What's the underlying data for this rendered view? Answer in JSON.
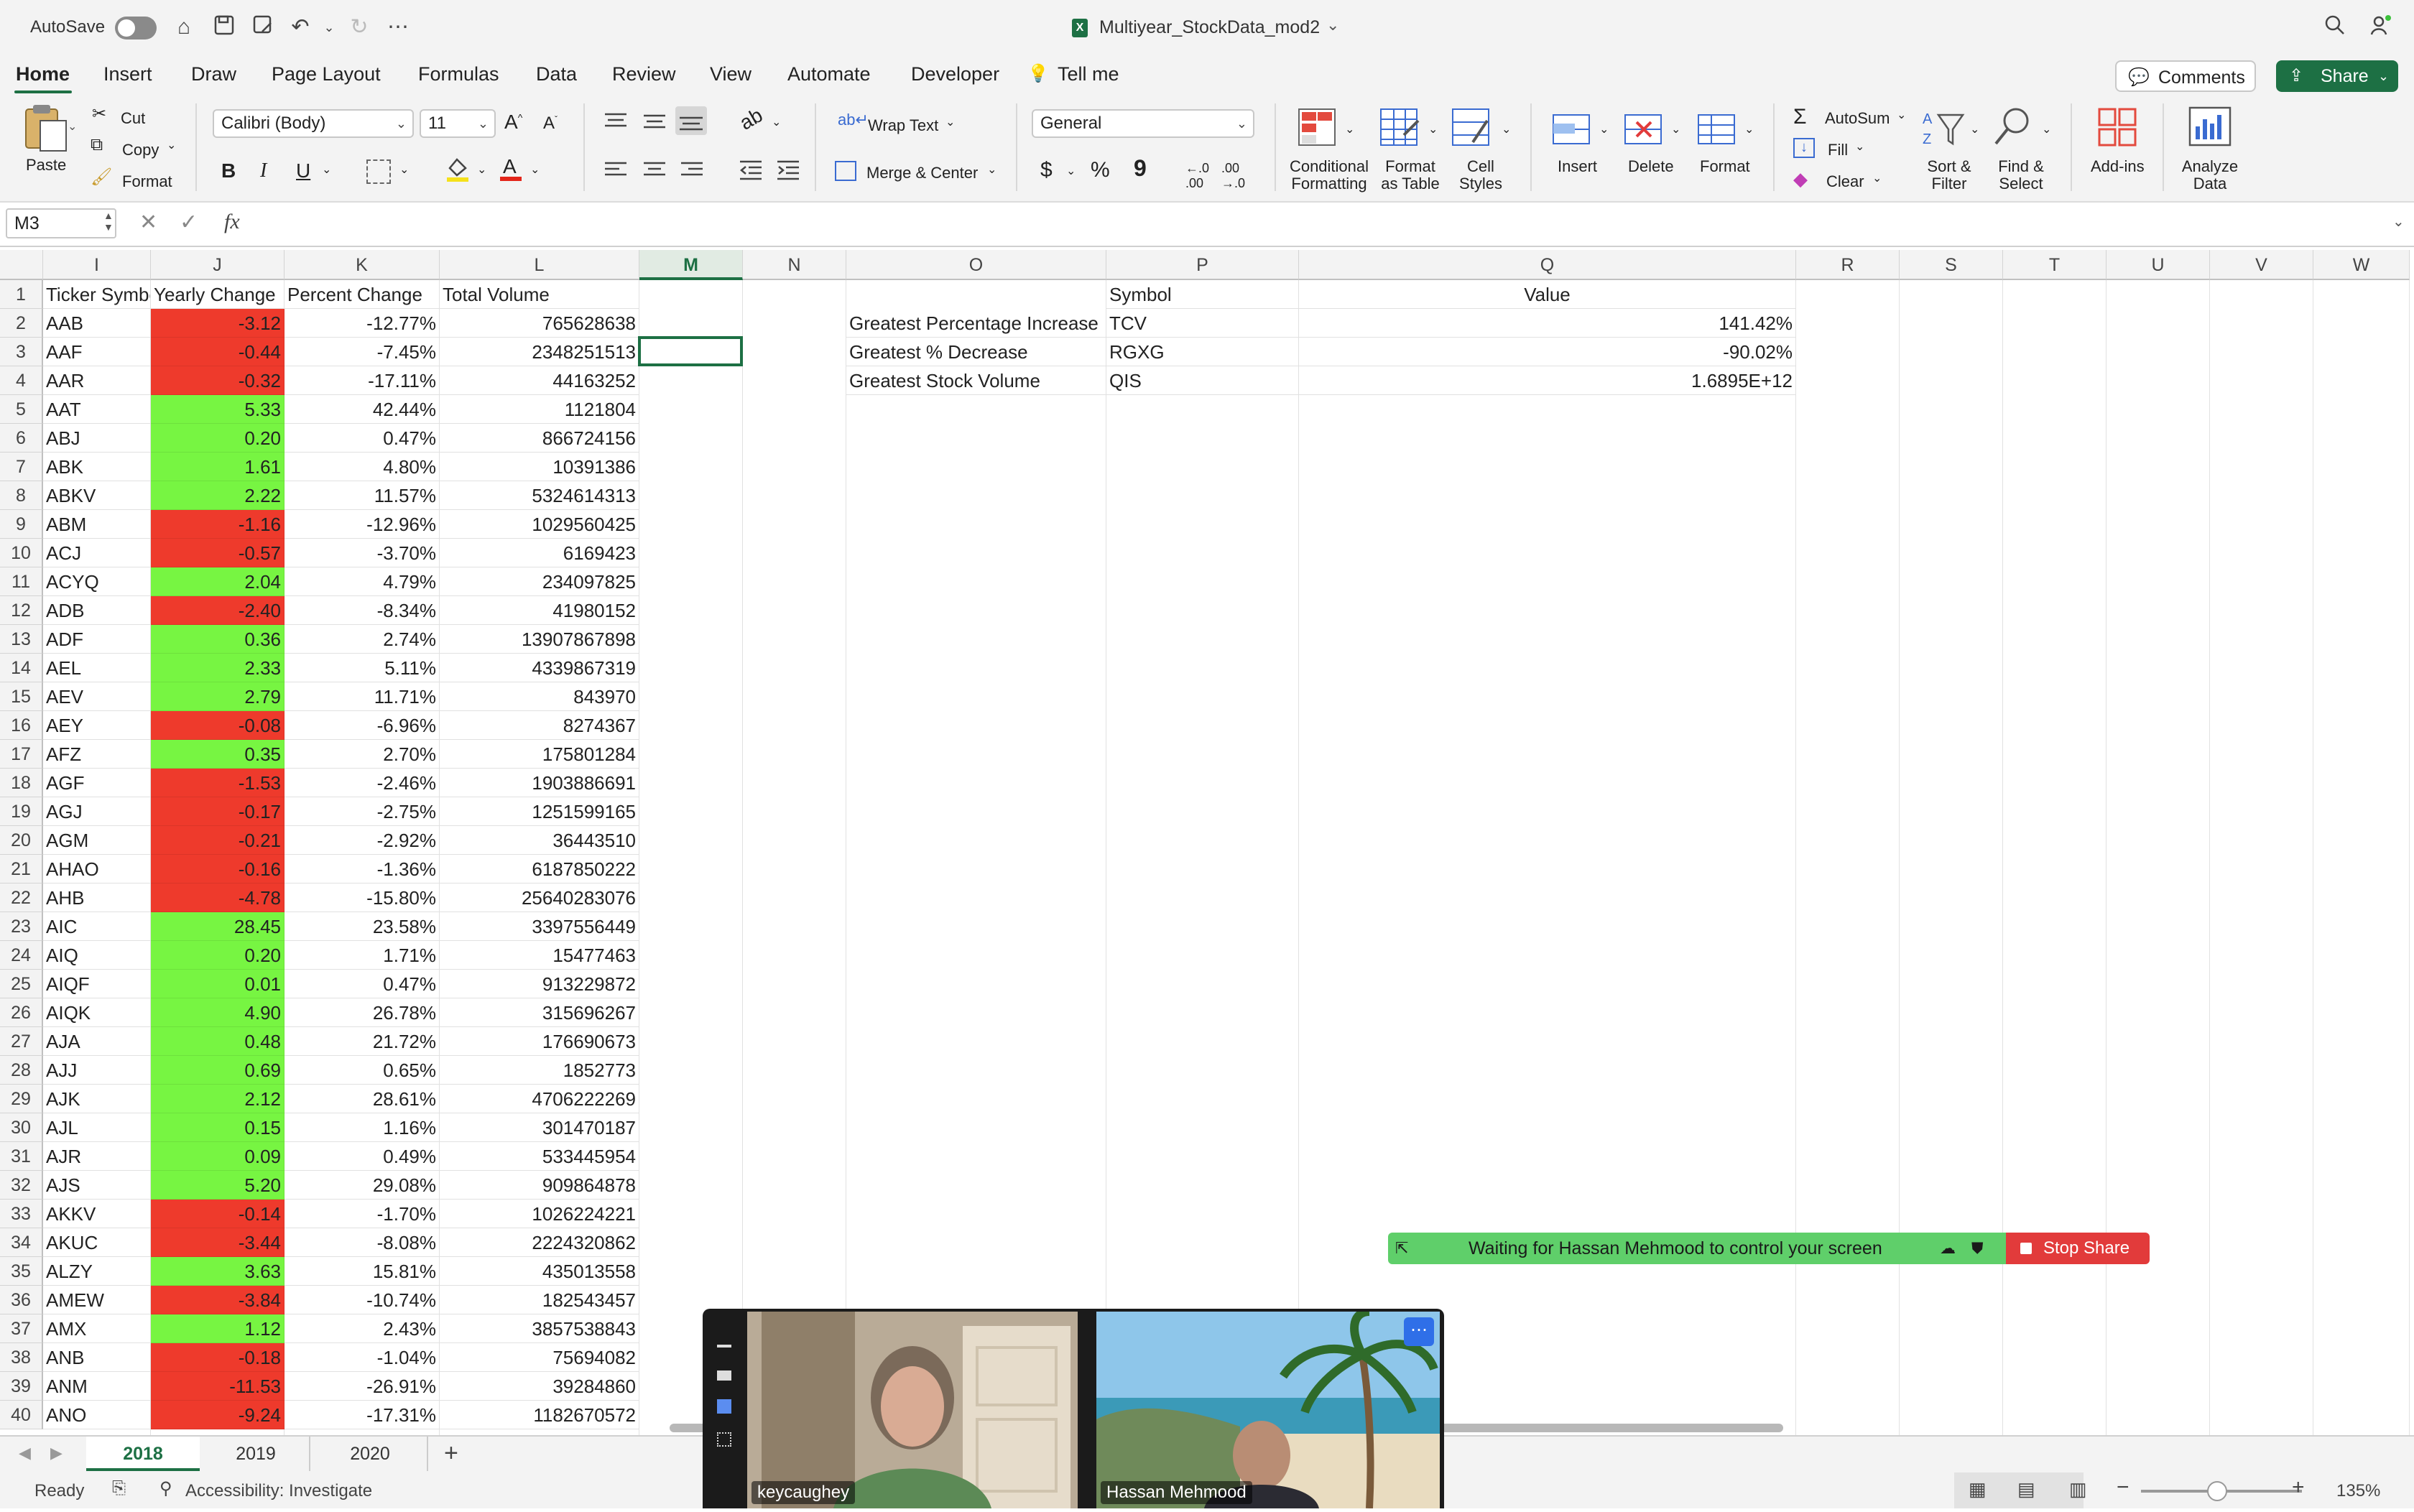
{
  "app": {
    "autosave_label": "AutoSave",
    "doc_title": "Multiyear_StockData_mod2",
    "tabs": [
      "Home",
      "Insert",
      "Draw",
      "Page Layout",
      "Formulas",
      "Data",
      "Review",
      "View",
      "Automate",
      "Developer",
      "Tell me"
    ],
    "comments_label": "Comments",
    "share_label": "Share"
  },
  "ribbon": {
    "paste": "Paste",
    "cut": "Cut",
    "copy": "Copy",
    "format_painter": "Format",
    "font_name": "Calibri (Body)",
    "font_size": "11",
    "bold": "B",
    "italic": "I",
    "underline": "U",
    "wrap_text": "Wrap Text",
    "merge_center": "Merge & Center",
    "number_format": "General",
    "conditional_formatting": [
      "Conditional",
      "Formatting"
    ],
    "format_as_table": [
      "Format",
      "as Table"
    ],
    "cell_styles": [
      "Cell",
      "Styles"
    ],
    "insert": "Insert",
    "delete": "Delete",
    "format": "Format",
    "autosum": "AutoSum",
    "fill": "Fill",
    "clear": "Clear",
    "sort_filter": [
      "Sort &",
      "Filter"
    ],
    "find_select": [
      "Find &",
      "Select"
    ],
    "addins": "Add-ins",
    "analyze_data": [
      "Analyze",
      "Data"
    ],
    "dollar": "$",
    "percent": "%",
    "comma": "9"
  },
  "formula_bar": {
    "name_box": "M3",
    "fx": "fx",
    "content": ""
  },
  "columns": [
    "I",
    "J",
    "K",
    "L",
    "M",
    "N",
    "O",
    "P",
    "Q",
    "R",
    "S",
    "T",
    "U",
    "V",
    "W"
  ],
  "selected_column": "M",
  "headers": {
    "ticker": "Ticker Symbol",
    "yearly": "Yearly Change",
    "percent": "Percent Change",
    "volume": "Total Volume",
    "symbol": "Symbol",
    "value": "Value"
  },
  "rows": [
    {
      "ticker": "AAB",
      "yearly": "-3.12",
      "percent": "-12.77%",
      "volume": "765628638"
    },
    {
      "ticker": "AAF",
      "yearly": "-0.44",
      "percent": "-7.45%",
      "volume": "2348251513"
    },
    {
      "ticker": "AAR",
      "yearly": "-0.32",
      "percent": "-17.11%",
      "volume": "44163252"
    },
    {
      "ticker": "AAT",
      "yearly": "5.33",
      "percent": "42.44%",
      "volume": "1121804"
    },
    {
      "ticker": "ABJ",
      "yearly": "0.20",
      "percent": "0.47%",
      "volume": "866724156"
    },
    {
      "ticker": "ABK",
      "yearly": "1.61",
      "percent": "4.80%",
      "volume": "10391386"
    },
    {
      "ticker": "ABKV",
      "yearly": "2.22",
      "percent": "11.57%",
      "volume": "5324614313"
    },
    {
      "ticker": "ABM",
      "yearly": "-1.16",
      "percent": "-12.96%",
      "volume": "1029560425"
    },
    {
      "ticker": "ACJ",
      "yearly": "-0.57",
      "percent": "-3.70%",
      "volume": "6169423"
    },
    {
      "ticker": "ACYQ",
      "yearly": "2.04",
      "percent": "4.79%",
      "volume": "234097825"
    },
    {
      "ticker": "ADB",
      "yearly": "-2.40",
      "percent": "-8.34%",
      "volume": "41980152"
    },
    {
      "ticker": "ADF",
      "yearly": "0.36",
      "percent": "2.74%",
      "volume": "13907867898"
    },
    {
      "ticker": "AEL",
      "yearly": "2.33",
      "percent": "5.11%",
      "volume": "4339867319"
    },
    {
      "ticker": "AEV",
      "yearly": "2.79",
      "percent": "11.71%",
      "volume": "843970"
    },
    {
      "ticker": "AEY",
      "yearly": "-0.08",
      "percent": "-6.96%",
      "volume": "8274367"
    },
    {
      "ticker": "AFZ",
      "yearly": "0.35",
      "percent": "2.70%",
      "volume": "175801284"
    },
    {
      "ticker": "AGF",
      "yearly": "-1.53",
      "percent": "-2.46%",
      "volume": "1903886691"
    },
    {
      "ticker": "AGJ",
      "yearly": "-0.17",
      "percent": "-2.75%",
      "volume": "1251599165"
    },
    {
      "ticker": "AGM",
      "yearly": "-0.21",
      "percent": "-2.92%",
      "volume": "36443510"
    },
    {
      "ticker": "AHAO",
      "yearly": "-0.16",
      "percent": "-1.36%",
      "volume": "6187850222"
    },
    {
      "ticker": "AHB",
      "yearly": "-4.78",
      "percent": "-15.80%",
      "volume": "25640283076"
    },
    {
      "ticker": "AIC",
      "yearly": "28.45",
      "percent": "23.58%",
      "volume": "3397556449"
    },
    {
      "ticker": "AIQ",
      "yearly": "0.20",
      "percent": "1.71%",
      "volume": "15477463"
    },
    {
      "ticker": "AIQF",
      "yearly": "0.01",
      "percent": "0.47%",
      "volume": "913229872"
    },
    {
      "ticker": "AIQK",
      "yearly": "4.90",
      "percent": "26.78%",
      "volume": "315696267"
    },
    {
      "ticker": "AJA",
      "yearly": "0.48",
      "percent": "21.72%",
      "volume": "176690673"
    },
    {
      "ticker": "AJJ",
      "yearly": "0.69",
      "percent": "0.65%",
      "volume": "1852773"
    },
    {
      "ticker": "AJK",
      "yearly": "2.12",
      "percent": "28.61%",
      "volume": "4706222269"
    },
    {
      "ticker": "AJL",
      "yearly": "0.15",
      "percent": "1.16%",
      "volume": "301470187"
    },
    {
      "ticker": "AJR",
      "yearly": "0.09",
      "percent": "0.49%",
      "volume": "533445954"
    },
    {
      "ticker": "AJS",
      "yearly": "5.20",
      "percent": "29.08%",
      "volume": "909864878"
    },
    {
      "ticker": "AKKV",
      "yearly": "-0.14",
      "percent": "-1.70%",
      "volume": "1026224221"
    },
    {
      "ticker": "AKUC",
      "yearly": "-3.44",
      "percent": "-8.08%",
      "volume": "2224320862"
    },
    {
      "ticker": "ALZY",
      "yearly": "3.63",
      "percent": "15.81%",
      "volume": "435013558"
    },
    {
      "ticker": "AMEW",
      "yearly": "-3.84",
      "percent": "-10.74%",
      "volume": "182543457"
    },
    {
      "ticker": "AMX",
      "yearly": "1.12",
      "percent": "2.43%",
      "volume": "3857538843"
    },
    {
      "ticker": "ANB",
      "yearly": "-0.18",
      "percent": "-1.04%",
      "volume": "75694082"
    },
    {
      "ticker": "ANM",
      "yearly": "-11.53",
      "percent": "-26.91%",
      "volume": "39284860"
    },
    {
      "ticker": "ANO",
      "yearly": "-9.24",
      "percent": "-17.31%",
      "volume": "1182670572"
    }
  ],
  "summary": [
    {
      "label": "Greatest Percentage Increase",
      "symbol": "TCV",
      "value": "141.42%"
    },
    {
      "label": "Greatest % Decrease",
      "symbol": "RGXG",
      "value": "-90.02%"
    },
    {
      "label": "Greatest Stock Volume",
      "symbol": "QIS",
      "value": "1.6895E+12"
    }
  ],
  "colors": {
    "positive_fill": "#77f542",
    "negative_fill": "#ee3a2c",
    "accent": "#1d7044"
  },
  "sheets": [
    "2018",
    "2019",
    "2020"
  ],
  "active_sheet": "2018",
  "status": {
    "ready": "Ready",
    "accessibility": "Accessibility: Investigate",
    "zoom": "135%"
  },
  "zoom_share": {
    "waiting": "Waiting for Hassan Mehmood to control your screen",
    "stop": "Stop Share",
    "participants": [
      "keycaughey",
      "Hassan Mehmood"
    ]
  }
}
